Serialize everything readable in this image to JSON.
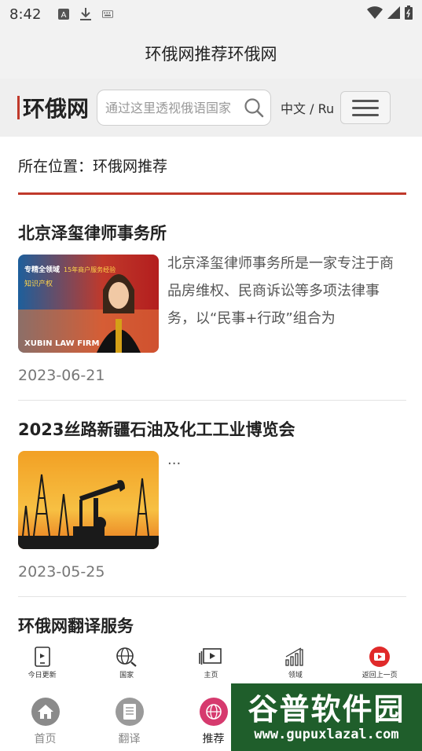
{
  "status_bar": {
    "time": "8:42"
  },
  "title_bar": {
    "title": "环俄网推荐环俄网"
  },
  "header": {
    "logo": "环俄网",
    "search_placeholder": "通过这里透视俄语国家",
    "lang": "中文 / Ru"
  },
  "breadcrumb": "所在位置：环俄网推荐",
  "articles": [
    {
      "title": "北京泽玺律师事务所",
      "excerpt": "北京泽玺律师事务所是一家专注于商品房维权、民商诉讼等多项法律事务，以“民事+行政”组合为",
      "date": "2023-06-21",
      "thumb_text": [
        "专精全领域",
        "15年商户服务经验",
        "知识产权",
        "XUBIN LAW FIRM"
      ]
    },
    {
      "title": "2023丝路新疆石油及化工工业博览会",
      "excerpt": "...",
      "date": "2023-05-25"
    },
    {
      "title": "环俄网翻译服务"
    }
  ],
  "float_bar": [
    {
      "label": "今日更新",
      "icon": "tablet-icon"
    },
    {
      "label": "国家",
      "icon": "globe-search-icon"
    },
    {
      "label": "主页",
      "icon": "video-icon"
    },
    {
      "label": "领域",
      "icon": "signal-bars-icon"
    },
    {
      "label": "返回上一页",
      "icon": "back-play-icon"
    }
  ],
  "tab_bar": [
    {
      "label": "首页",
      "icon": "home-icon"
    },
    {
      "label": "翻译",
      "icon": "document-icon"
    },
    {
      "label": "推荐",
      "icon": "globe-icon"
    }
  ],
  "watermark": {
    "main": "谷普软件园",
    "url": "www.gupuxlazal.com"
  },
  "colors": {
    "accent": "#c0392b",
    "recommend_active": "#d63a6e",
    "watermark_bg": "#1f5e2b"
  }
}
